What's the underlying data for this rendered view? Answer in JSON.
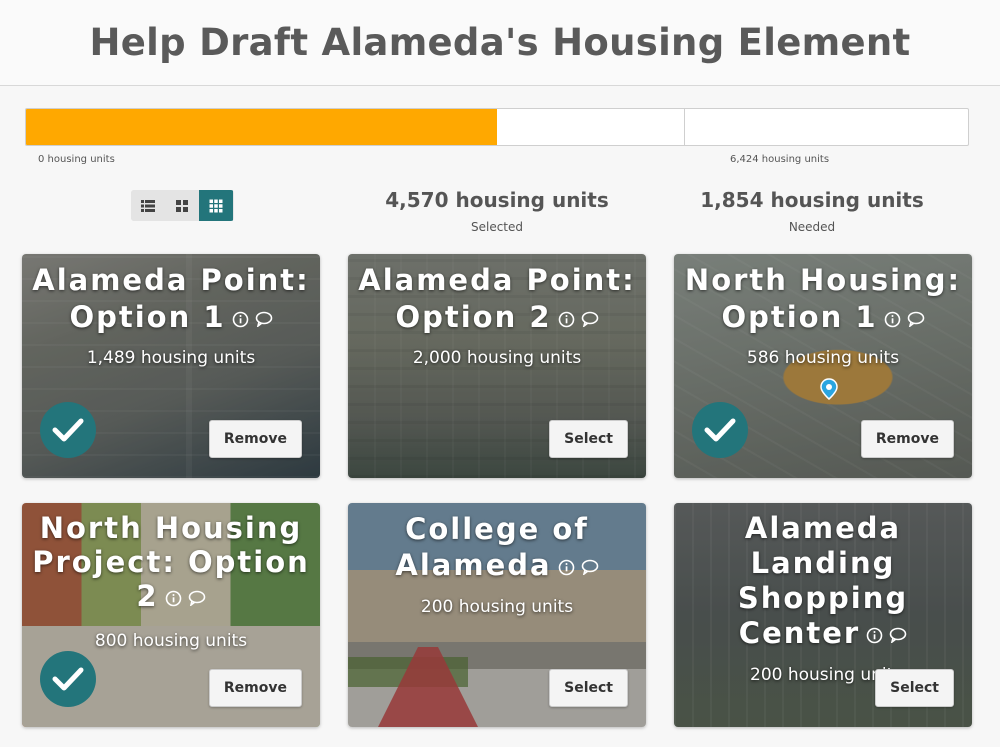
{
  "header": {
    "title": "Help Draft Alameda's Housing Element"
  },
  "progress": {
    "filled_fraction": 0.4996,
    "min_label": "0 housing units",
    "max_label": "6,424 housing units",
    "fill_color": "#ffa800"
  },
  "view_toggle": {
    "options": [
      "list-view-icon",
      "small-grid-icon",
      "large-grid-icon"
    ],
    "active": "large-grid-icon"
  },
  "stats": {
    "selected_value": "4,570 housing units",
    "selected_label": "Selected",
    "needed_value": "1,854 housing units",
    "needed_label": "Needed"
  },
  "cards": [
    {
      "title": "Alameda Point: Option 1",
      "units": "1,489 housing units",
      "selected": true,
      "action": "Remove"
    },
    {
      "title": "Alameda Point: Option 2",
      "units": "2,000 housing units",
      "selected": false,
      "action": "Select"
    },
    {
      "title": "North Housing: Option 1",
      "units": "586 housing units",
      "selected": true,
      "action": "Remove"
    },
    {
      "title": "North Housing Project: Option 2",
      "units": "800 housing units",
      "selected": true,
      "action": "Remove"
    },
    {
      "title": "College of Alameda",
      "units": "200 housing units",
      "selected": false,
      "action": "Select"
    },
    {
      "title": "Alameda Landing Shopping Center",
      "units": "200 housing units",
      "selected": false,
      "action": "Select"
    }
  ],
  "colors": {
    "accent": "#23757b",
    "progress": "#ffa800"
  }
}
